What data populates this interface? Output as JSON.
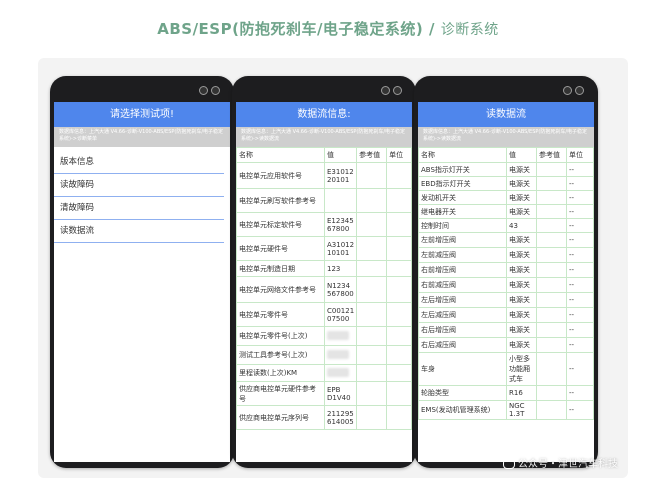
{
  "header": {
    "title": "ABS/ESP(防抱死刹车/电子稳定系统)",
    "separator": "/",
    "subtitle": "诊断系统"
  },
  "phone1": {
    "title": "请选择测试项!",
    "info": "数据库信息：上汽大通 V4.66-诊断-V100-ABS/ESP(防抱死刹车/电子稳定系统)->诊断菜单",
    "menu": [
      "版本信息",
      "读故障码",
      "清故障码",
      "读数据流"
    ]
  },
  "phone2": {
    "title": "数据流信息:",
    "info": "数据库信息：上汽大通 V4.66-诊断-V100-ABS/ESP(防抱死刹车/电子稳定系统)->读数据流",
    "columns": [
      "名称",
      "值",
      "参考值",
      "单位"
    ],
    "rows": [
      {
        "name": "电控单元应用软件号",
        "value": "E31012 20101",
        "ref": "",
        "unit": ""
      },
      {
        "name": "电控单元刷写软件参考号",
        "value": "",
        "ref": "",
        "unit": ""
      },
      {
        "name": "电控单元标定软件号",
        "value": "E12345 67800",
        "ref": "",
        "unit": ""
      },
      {
        "name": "电控单元硬件号",
        "value": "A31012 10101",
        "ref": "",
        "unit": ""
      },
      {
        "name": "电控单元制造日期",
        "value": "123",
        "ref": "",
        "unit": ""
      },
      {
        "name": "电控单元网络文件参考号",
        "value": "N1234 567800",
        "ref": "",
        "unit": ""
      },
      {
        "name": "电控单元零件号",
        "value": "C00121 07500",
        "ref": "",
        "unit": ""
      },
      {
        "name": "电控单元零件号(上次)",
        "value": "",
        "ref": "",
        "unit": "",
        "blur": true
      },
      {
        "name": "测试工具参考号(上次)",
        "value": "",
        "ref": "",
        "unit": "",
        "blur": true
      },
      {
        "name": "里程读数(上次)KM",
        "value": "",
        "ref": "",
        "unit": "",
        "blur": true
      },
      {
        "name": "供应商电控单元硬件参考号",
        "value": "EPB D1V40",
        "ref": "",
        "unit": ""
      },
      {
        "name": "供应商电控单元序列号",
        "value": "211295 614005",
        "ref": "",
        "unit": ""
      }
    ]
  },
  "phone3": {
    "title": "读数据流",
    "info": "数据库信息：上汽大通 V4.66-诊断-V100-ABS/ESP(防抱死刹车/电子稳定系统)->读数据流",
    "columns": [
      "名称",
      "值",
      "参考值",
      "单位"
    ],
    "rows": [
      {
        "name": "ABS指示灯开关",
        "value": "电源关",
        "ref": "",
        "unit": "--"
      },
      {
        "name": "EBD指示灯开关",
        "value": "电源关",
        "ref": "",
        "unit": "--"
      },
      {
        "name": "发动机开关",
        "value": "电源关",
        "ref": "",
        "unit": "--"
      },
      {
        "name": "继电器开关",
        "value": "电源关",
        "ref": "",
        "unit": "--"
      },
      {
        "name": "控制时间",
        "value": "43",
        "ref": "",
        "unit": "--"
      },
      {
        "name": "左前增压阀",
        "value": "电源关",
        "ref": "",
        "unit": "--"
      },
      {
        "name": "左前减压阀",
        "value": "电源关",
        "ref": "",
        "unit": "--"
      },
      {
        "name": "右前增压阀",
        "value": "电源关",
        "ref": "",
        "unit": "--"
      },
      {
        "name": "右前减压阀",
        "value": "电源关",
        "ref": "",
        "unit": "--"
      },
      {
        "name": "左后增压阀",
        "value": "电源关",
        "ref": "",
        "unit": "--"
      },
      {
        "name": "左后减压阀",
        "value": "电源关",
        "ref": "",
        "unit": "--"
      },
      {
        "name": "右后增压阀",
        "value": "电源关",
        "ref": "",
        "unit": "--"
      },
      {
        "name": "右后减压阀",
        "value": "电源关",
        "ref": "",
        "unit": "--"
      },
      {
        "name": "车身",
        "value": "小型多功能厢式车",
        "ref": "",
        "unit": "--"
      },
      {
        "name": "轮胎类型",
        "value": "R16",
        "ref": "",
        "unit": "--"
      },
      {
        "name": "EMS(发动机管理系统)",
        "value": "NGC 1.3T",
        "ref": "",
        "unit": "--"
      }
    ]
  },
  "watermark": "公众号・津世汽车科技",
  "colors": {
    "accent": "#4f86ec",
    "header": "#6fa48a",
    "grid": "#c8e8c8"
  }
}
